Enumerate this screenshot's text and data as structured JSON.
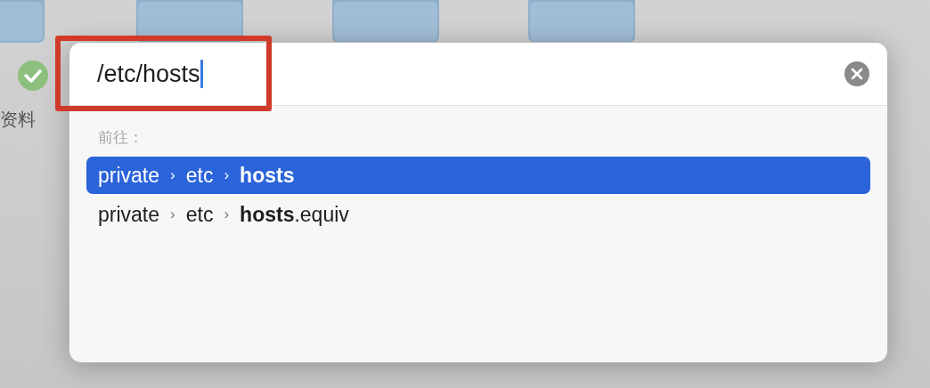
{
  "desktop": {
    "label": "资料",
    "synced": true
  },
  "dialog": {
    "path": {
      "value": "/etc/hosts"
    },
    "section_label": "前往：",
    "results": [
      {
        "selected": true,
        "parts": [
          {
            "kind": "folder",
            "text": "private"
          },
          {
            "kind": "separator",
            "text": "›"
          },
          {
            "kind": "folder",
            "text": "etc"
          },
          {
            "kind": "separator",
            "text": "›"
          },
          {
            "kind": "file",
            "text": "**hosts**"
          }
        ]
      },
      {
        "selected": false,
        "parts": [
          {
            "kind": "folder",
            "text": "private"
          },
          {
            "kind": "separator",
            "text": "›"
          },
          {
            "kind": "folder",
            "text": "etc"
          },
          {
            "kind": "separator",
            "text": "›"
          },
          {
            "kind": "file",
            "text": "**hosts**.equiv"
          }
        ]
      }
    ]
  },
  "annotation": {
    "kind": "highlight"
  }
}
